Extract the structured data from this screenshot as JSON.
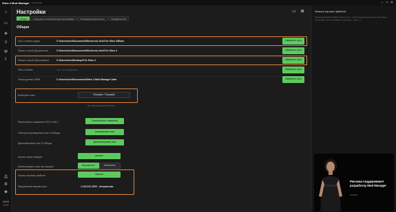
{
  "window": {
    "app_name": "Sims 4 Mod Manager",
    "subtitle": "by ghost4ik",
    "min_icon": "minimize-icon",
    "max_icon": "maximize-icon",
    "close_icon": "close-icon"
  },
  "rail": {
    "items": [
      "home-icon",
      "folder-icon",
      "mods-icon",
      "sliders-icon",
      "wrench-icon",
      "download-icon"
    ],
    "bottom_items": [
      "printer-icon",
      "gear-icon",
      "sims-logo-icon"
    ],
    "version_label": "(beta)",
    "version": "1.2.0"
  },
  "header": {
    "title": "Настройки",
    "icons": [
      "folder-icon",
      "folder-add-icon"
    ]
  },
  "tabs": [
    {
      "label": "Общее",
      "active": true
    },
    {
      "label": "Нагрузка и внешний вид программы",
      "active": false
    },
    {
      "label": "Конфиденциальность",
      "active": false
    },
    {
      "label": "Продвинутый",
      "active": false
    }
  ],
  "section_title": "Общее",
  "paths": [
    {
      "label": "Путь к папке модов",
      "value": "C:\\Users\\Axel\\Documents\\Electronic Arts\\The Sims 4\\Mods",
      "button": "Изменить путь"
    },
    {
      "label": "Папка с игрой (Документы)",
      "value": "C:\\Users\\Axel\\Documents\\Electronic Arts\\The Sims 4",
      "button": "Изменить путь"
    },
    {
      "label": "Папка с игрой (Программы)",
      "value": "C:\\Users\\Axel\\Desktop\\The Sims 4",
      "button": "Изменить путь"
    },
    {
      "label": "Sims 4 Studio",
      "value": "Путь не обнаружен...",
      "button": "Изменить путь"
    },
    {
      "label": "Папка данных SMM",
      "value": "C:\\Users\\Axel\\Documents\\Sims 4 Mod Manager Data",
      "button": "Изменить путь"
    }
  ],
  "language": {
    "label": "Выберите язык",
    "value": "Russian / Русский",
    "note": "2% перевод сделан Shrimax"
  },
  "options": [
    {
      "label": "Переключить названия CAS и CMLJ",
      "button": "Переключить названия"
    },
    {
      "label": "Повторно активировать все CC/Моды",
      "button": "Активировать все"
    },
    {
      "label": "Деактивировать все CC/Моды",
      "button": "Деактивировать все"
    }
  ],
  "cache": {
    "label": "Анализ кэша позиции",
    "button": "Анализ",
    "auto_label": "Анализировать кэш при запуске",
    "on": "Выключено",
    "off": "Включено"
  },
  "analysis": {
    "label": "Анализ игровых файлов",
    "button": "Анализ",
    "version_label": "Загруженная версия игры",
    "version_value": "1.116.211.1020 - Актуальная"
  },
  "right_panel": {
    "title": "Анализ игровых файлов",
    "description": "Проанализируйте файлы своей игры. Чтобы мод-менеджер мог распознать использует ли CC элементы (текстуры, меши...)",
    "ad_title": "Реклама поддерживает разработку Mod Manager",
    "ad_thanks": "спасибо"
  },
  "colors": {
    "accent": "#5ec95f",
    "highlight": "#e8843c",
    "background": "#1c1c1c"
  }
}
